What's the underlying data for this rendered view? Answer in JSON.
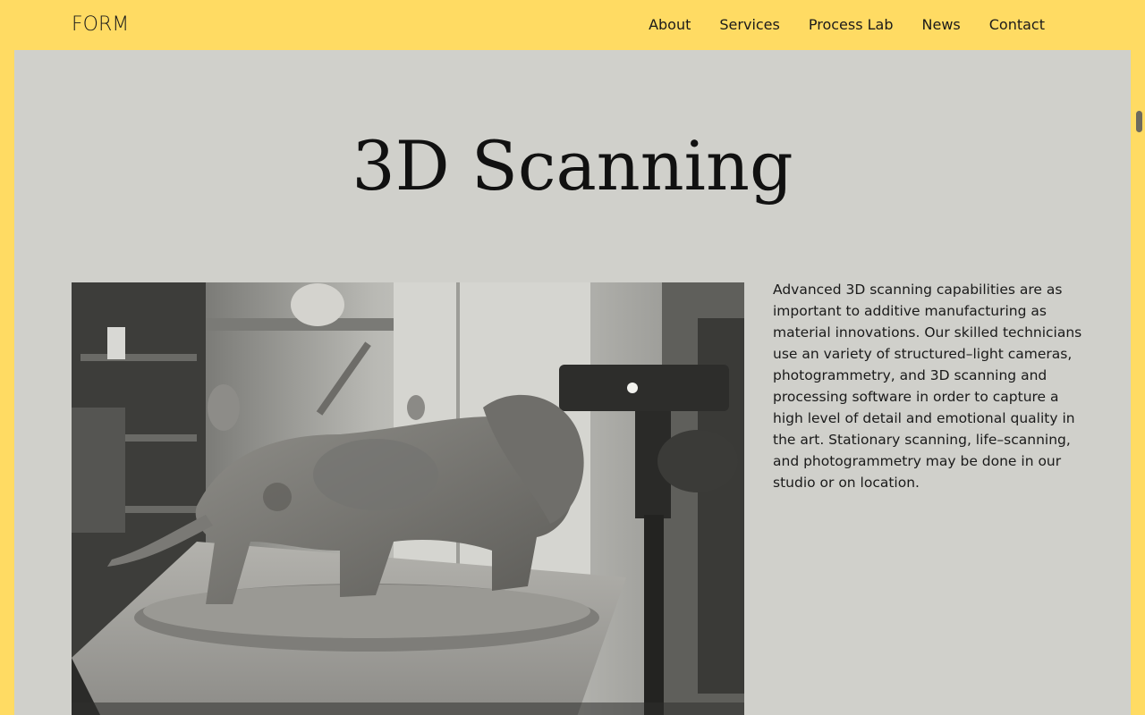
{
  "brand": {
    "logo_text": "FORM"
  },
  "nav": {
    "items": [
      {
        "label": "About"
      },
      {
        "label": "Services"
      },
      {
        "label": "Process Lab"
      },
      {
        "label": "News"
      },
      {
        "label": "Contact"
      }
    ]
  },
  "main": {
    "title": "3D Scanning",
    "description": "Advanced 3D scanning capabilities are as important to additive manufacturing as material innovations. Our skilled technicians use an variety of structured–light cameras, photogrammetry, and 3D scanning and processing software in order to capture a high level of detail and emotional quality in the art. Stationary scanning, life–scanning, and photogrammetry may be done in our studio or on location."
  },
  "colors": {
    "page_background": "#FFDB63",
    "panel_background": "#D0D0CB",
    "text": "#1a1a1a"
  }
}
